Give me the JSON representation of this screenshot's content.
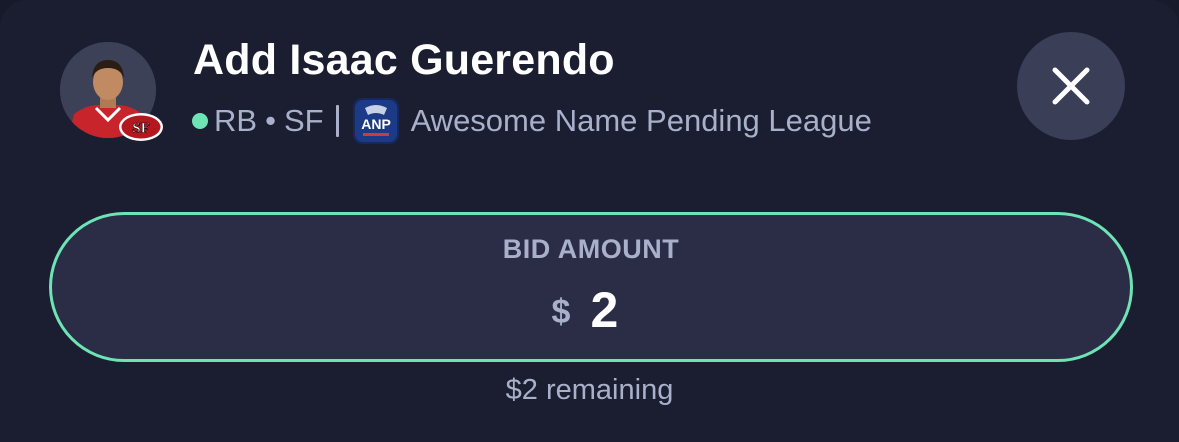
{
  "header": {
    "title": "Add Isaac Guerendo",
    "position": "RB",
    "separator": "•",
    "team": "SF",
    "league_name": "Awesome Name Pending League",
    "league_logo_text": "ANP",
    "team_badge_text": "SF",
    "status_color": "#6ee3b4"
  },
  "bid": {
    "label": "BID AMOUNT",
    "currency": "$",
    "amount": "2",
    "remaining": "$2 remaining",
    "accent": "#6ee3b4"
  },
  "icons": {
    "close": "close-icon",
    "avatar": "player-avatar",
    "team": "49ers-logo-icon",
    "league": "league-logo-icon"
  }
}
